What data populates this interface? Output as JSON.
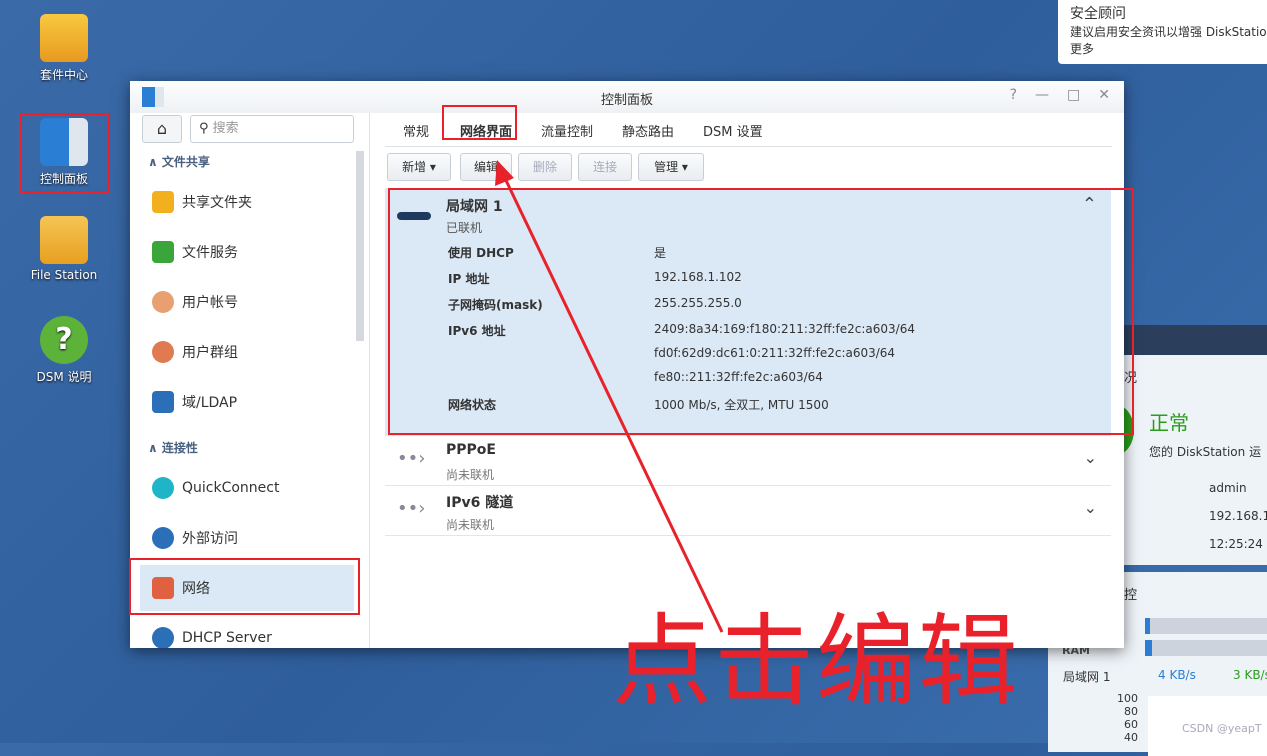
{
  "desktop": {
    "icons": [
      {
        "label": "套件中心",
        "icon": "package-center-icon"
      },
      {
        "label": "控制面板",
        "icon": "control-panel-icon"
      },
      {
        "label": "File Station",
        "icon": "folder-search-icon"
      },
      {
        "label": "DSM 说明",
        "icon": "help-icon"
      }
    ]
  },
  "notification": {
    "title": "安全顾问",
    "body": "建议启用安全资讯以增强 DiskStation",
    "more": "更多"
  },
  "window": {
    "title": "控制面板",
    "controls": [
      "?",
      "—",
      "□",
      "✕"
    ]
  },
  "sidebar": {
    "search_placeholder": "搜索",
    "sections": [
      {
        "title": "文件共享",
        "items": [
          "共享文件夹",
          "文件服务",
          "用户帐号",
          "用户群组",
          "域/LDAP"
        ]
      },
      {
        "title": "连接性",
        "items": [
          "QuickConnect",
          "外部访问",
          "网络",
          "DHCP Server"
        ]
      }
    ],
    "selected": "网络"
  },
  "tabs": [
    "常规",
    "网络界面",
    "流量控制",
    "静态路由",
    "DSM 设置"
  ],
  "active_tab": "网络界面",
  "toolbar": {
    "add": "新增",
    "edit": "编辑",
    "delete": "删除",
    "connect": "连接",
    "manage": "管理"
  },
  "interfaces": [
    {
      "name": "局域网 1",
      "status": "已联机",
      "expanded": true,
      "details": [
        {
          "k": "使用 DHCP",
          "v": "是"
        },
        {
          "k": "IP 地址",
          "v": "192.168.1.102"
        },
        {
          "k": "子网掩码(mask)",
          "v": "255.255.255.0"
        },
        {
          "k": "IPv6 地址",
          "v": "2409:8a34:169:f180:211:32ff:fe2c:a603/64"
        },
        {
          "k": "",
          "v": "fd0f:62d9:dc61:0:211:32ff:fe2c:a603/64"
        },
        {
          "k": "",
          "v": "fe80::211:32ff:fe2c:a603/64"
        },
        {
          "k": "网络状态",
          "v": "1000 Mb/s, 全双工, MTU 1500"
        }
      ]
    },
    {
      "name": "PPPoE",
      "status": "尚未联机"
    },
    {
      "name": "IPv6 隧道",
      "status": "尚未联机"
    }
  ],
  "background_widget": {
    "health_title": "况",
    "health_status": "正常",
    "health_desc": "您的 DiskStation 运",
    "user": "admin",
    "ip": "192.168.1",
    "time": "12:25:24",
    "monitor_title": "控",
    "ram": "RAM",
    "net": "局域网 1",
    "up": "4 KB/s",
    "down": "3 KB/s",
    "yticks": [
      "100",
      "80",
      "60",
      "40"
    ]
  },
  "annotation": "点击编辑",
  "watermark": "CSDN @yeapT",
  "colors": {
    "annotation": "#e8212a",
    "selected": "#dbe8f5",
    "healthy": "#2a9d1a"
  }
}
